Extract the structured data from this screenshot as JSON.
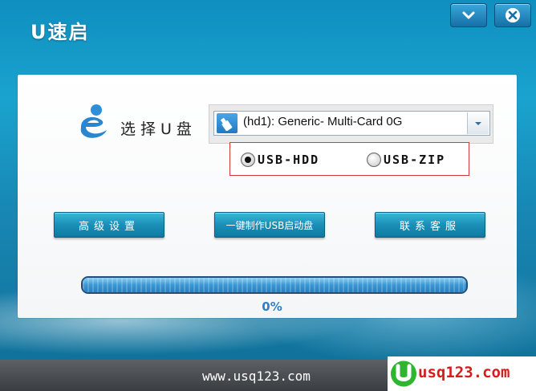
{
  "window": {
    "title": "U速启",
    "minimize_icon": "chevron-down-icon",
    "close_icon": "close-icon"
  },
  "select": {
    "label": "选择U盘",
    "value": "(hd1): Generic- Multi-Card 0G",
    "device_icon": "usb-drive-icon"
  },
  "modes": {
    "hdd": "USB-HDD",
    "zip": "USB-ZIP",
    "selected": "USB-HDD"
  },
  "buttons": {
    "advanced": "高级设置",
    "make": "一键制作USB启动盘",
    "service": "联系客服"
  },
  "progress": {
    "value": 1.0,
    "label": "0%"
  },
  "footer": {
    "url": "www.usq123.com"
  },
  "watermark": {
    "text": "usq123.com"
  },
  "colors": {
    "accent": "#1b8fb8",
    "progress_text": "#2f7fc7",
    "radio_border": "#d23a3a",
    "watermark": "#d81c1c"
  }
}
